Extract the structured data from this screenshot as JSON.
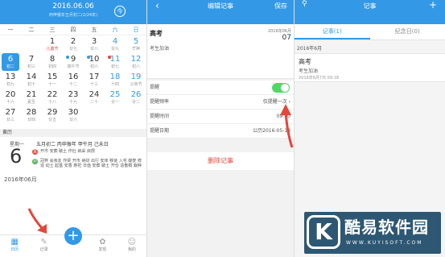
{
  "calendar": {
    "header_date": "2016.06.06",
    "header_sub": "丙申猴年五月初二(2/24年)",
    "today_label": "今",
    "weekdays": [
      "一",
      "二",
      "三",
      "四",
      "五",
      "六",
      "日"
    ],
    "cells": [
      {
        "n": "",
        "l": ""
      },
      {
        "n": "",
        "l": ""
      },
      {
        "n": "1",
        "l": "儿童节",
        "red": true
      },
      {
        "n": "2",
        "l": "廿七"
      },
      {
        "n": "3",
        "l": "廿八"
      },
      {
        "n": "4",
        "l": "廿九"
      },
      {
        "n": "5",
        "l": "芒种"
      },
      {
        "n": "6",
        "l": "初二",
        "sel": true
      },
      {
        "n": "7",
        "l": "初三"
      },
      {
        "n": "8",
        "l": "初四"
      },
      {
        "n": "9",
        "l": "端午节",
        "dot": "blue"
      },
      {
        "n": "10",
        "l": "初六",
        "dot": "blue"
      },
      {
        "n": "11",
        "l": "初七",
        "dot": "red"
      },
      {
        "n": "12",
        "l": "初八"
      },
      {
        "n": "13",
        "l": "初九"
      },
      {
        "n": "14",
        "l": "初十"
      },
      {
        "n": "15",
        "l": "十一"
      },
      {
        "n": "16",
        "l": "十二"
      },
      {
        "n": "17",
        "l": "十三"
      },
      {
        "n": "18",
        "l": "十四"
      },
      {
        "n": "19",
        "l": "父亲节"
      },
      {
        "n": "20",
        "l": "十六"
      },
      {
        "n": "21",
        "l": "夏至"
      },
      {
        "n": "22",
        "l": "十八"
      },
      {
        "n": "23",
        "l": "十九"
      },
      {
        "n": "24",
        "l": "二十"
      },
      {
        "n": "25",
        "l": "廿一"
      },
      {
        "n": "26",
        "l": "廿二"
      },
      {
        "n": "27",
        "l": "廿三"
      },
      {
        "n": "28",
        "l": "廿四"
      },
      {
        "n": "29",
        "l": "廿五"
      },
      {
        "n": "30",
        "l": "廿六"
      },
      {
        "n": "",
        "l": ""
      },
      {
        "n": "",
        "l": ""
      },
      {
        "n": "",
        "l": ""
      }
    ],
    "huangli_label": "黄历",
    "weekday_label": "星期一",
    "big_day": "6",
    "year_month": "2016年06月",
    "lunar": "五月初二 丙申猴年 甲午月 己未日",
    "yi_mark": "宜",
    "yi_text": "开市 安葬 破土 作灶 纳采 启攒",
    "ji_mark": "忌",
    "ji_text": "冠笄 会亲友 作梁 开市 纳财 出行 安床 移徙 入宅 嫁娶 修造 动土 起基 安香 祭祀 日值 安葬 破土 开仓 造畜稠 栽种",
    "tabs": [
      "日历",
      "记录",
      "",
      "发现",
      "我的"
    ]
  },
  "editor": {
    "back": "‹",
    "title": "编辑记事",
    "save": "保存",
    "note_title": "高考",
    "note_body": "考生加油",
    "date_top": "2016年06月",
    "date_day": "07",
    "rows": [
      {
        "label": "提醒",
        "value": ""
      },
      {
        "label": "提醒频率",
        "value": "仅提醒一次 ›"
      },
      {
        "label": "提醒时间",
        "value": "09:00"
      },
      {
        "label": "提醒日期",
        "value": "公历2016-05-19"
      }
    ],
    "delete": "删除记事"
  },
  "notes": {
    "search": "⚲",
    "title": "记事",
    "add": "+",
    "tabs": [
      "记事(1)",
      "纪念日(0)"
    ],
    "month": "2016年6月",
    "item_title": "高考",
    "item_body": "考生加油",
    "item_date": "2016年6月7日 09:18"
  },
  "watermark": {
    "logo": "K",
    "name": "酷易软件园",
    "url": "WWW.KUYISOFT.COM"
  },
  "colors": {
    "accent": "#3399e6",
    "red": "#e5453a",
    "green": "#4cd964"
  }
}
